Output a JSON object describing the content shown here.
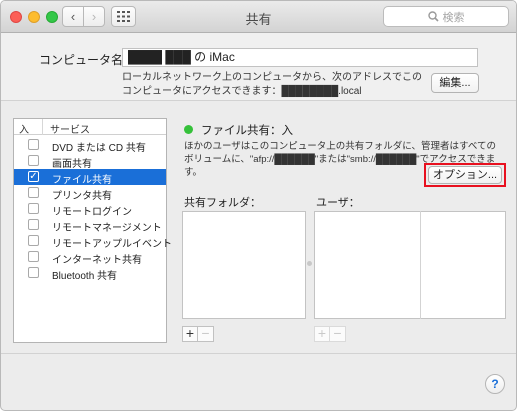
{
  "window": {
    "title": "共有",
    "search_placeholder": "検索"
  },
  "computer": {
    "label": "コンピュータ名：",
    "name_value": "████ ███ の iMac",
    "description": "ローカルネットワーク上のコンピュータから、次のアドレスでこのコンピュータにアクセスできます：████████.local",
    "edit_label": "編集..."
  },
  "services": {
    "header_on": "入",
    "header_service": "サービス",
    "items": [
      {
        "label": "DVD または CD 共有",
        "checked": false,
        "selected": false
      },
      {
        "label": "画面共有",
        "checked": false,
        "selected": false
      },
      {
        "label": "ファイル共有",
        "checked": true,
        "selected": true
      },
      {
        "label": "プリンタ共有",
        "checked": false,
        "selected": false
      },
      {
        "label": "リモートログイン",
        "checked": false,
        "selected": false
      },
      {
        "label": "リモートマネージメント",
        "checked": false,
        "selected": false
      },
      {
        "label": "リモートアップルイベント",
        "checked": false,
        "selected": false
      },
      {
        "label": "インターネット共有",
        "checked": false,
        "selected": false
      },
      {
        "label": "Bluetooth 共有",
        "checked": false,
        "selected": false
      }
    ]
  },
  "detail": {
    "status": "ファイル共有：入",
    "description": "ほかのユーザはこのコンピュータ上の共有フォルダに、管理者はすべてのボリュームに、\"afp://██████\"または\"smb://██████\"でアクセスできます。",
    "options_label": "オプション...",
    "shared_folders_label": "共有フォルダ：",
    "users_label": "ユーザ："
  },
  "icons": {
    "back": "chevron-left-icon",
    "forward": "chevron-right-icon",
    "grid": "grid-icon",
    "search": "search-icon",
    "help": "help-icon"
  },
  "colors": {
    "selection": "#1a6fd8",
    "status_on": "#35c13a",
    "highlight": "#e8101f"
  },
  "glyphs": {
    "plus": "+",
    "minus": "−",
    "help": "?",
    "back": "‹",
    "forward": "›",
    "check": "✓"
  }
}
